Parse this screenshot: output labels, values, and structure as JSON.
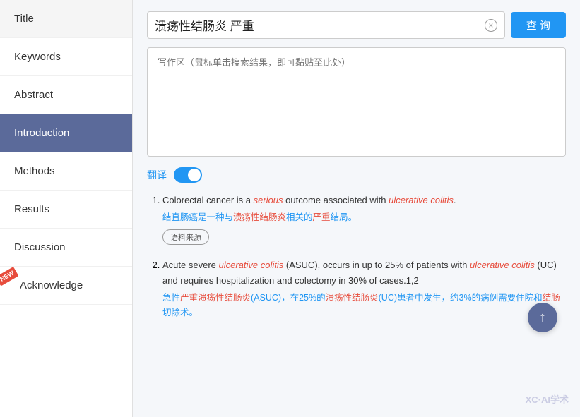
{
  "sidebar": {
    "items": [
      {
        "id": "title",
        "label": "Title",
        "active": false
      },
      {
        "id": "keywords",
        "label": "Keywords",
        "active": false
      },
      {
        "id": "abstract",
        "label": "Abstract",
        "active": false
      },
      {
        "id": "introduction",
        "label": "Introduction",
        "active": true
      },
      {
        "id": "methods",
        "label": "Methods",
        "active": false
      },
      {
        "id": "results",
        "label": "Results",
        "active": false
      },
      {
        "id": "discussion",
        "label": "Discussion",
        "active": false
      },
      {
        "id": "acknowledge",
        "label": "Acknowledge",
        "active": false,
        "badge": "NEW"
      }
    ]
  },
  "search": {
    "query": "溃疡性结肠炎 严重",
    "placeholder": "写作区（鼠标单击搜索结果，即可黏贴至此处）",
    "clear_label": "×",
    "query_btn": "查 询"
  },
  "translate": {
    "label": "翻译"
  },
  "results": [
    {
      "id": 1,
      "en_parts": [
        {
          "text": "Colorectal cancer is a ",
          "style": "normal"
        },
        {
          "text": "serious",
          "style": "italic-red"
        },
        {
          "text": " outcome associated with ",
          "style": "normal"
        },
        {
          "text": "ulcerative colitis",
          "style": "italic-red"
        },
        {
          "text": ".",
          "style": "normal"
        }
      ],
      "zh": "结直肠癌是一种与溃疡性结肠炎相关的严重结局。",
      "zh_highlight": [
        "溃疡性结肠炎",
        "严重"
      ],
      "source_badge": "语料来源"
    },
    {
      "id": 2,
      "en_parts": [
        {
          "text": "Acute severe ",
          "style": "normal"
        },
        {
          "text": "ulcerative colitis",
          "style": "italic-red"
        },
        {
          "text": " (ASUC), occurs in up to 25% of patients with ",
          "style": "normal"
        },
        {
          "text": "ulcerative colitis",
          "style": "italic-red"
        },
        {
          "text": " (UC) and requires hospitalization and colectomy in 30% of cases.1,2",
          "style": "normal"
        }
      ],
      "zh": "急性严重溃疡性结肠炎(ASUC)，在25%的溃疡性结肠炎(UC)患者中发生，约3%的病例需要住院和结肠切除术。",
      "zh_highlight": [
        "严重溃疡性结肠炎",
        "溃疡性结肠炎",
        "结肠"
      ],
      "source_badge": null
    }
  ],
  "watermark": "XC·AI学术",
  "scroll_up_label": "↑"
}
